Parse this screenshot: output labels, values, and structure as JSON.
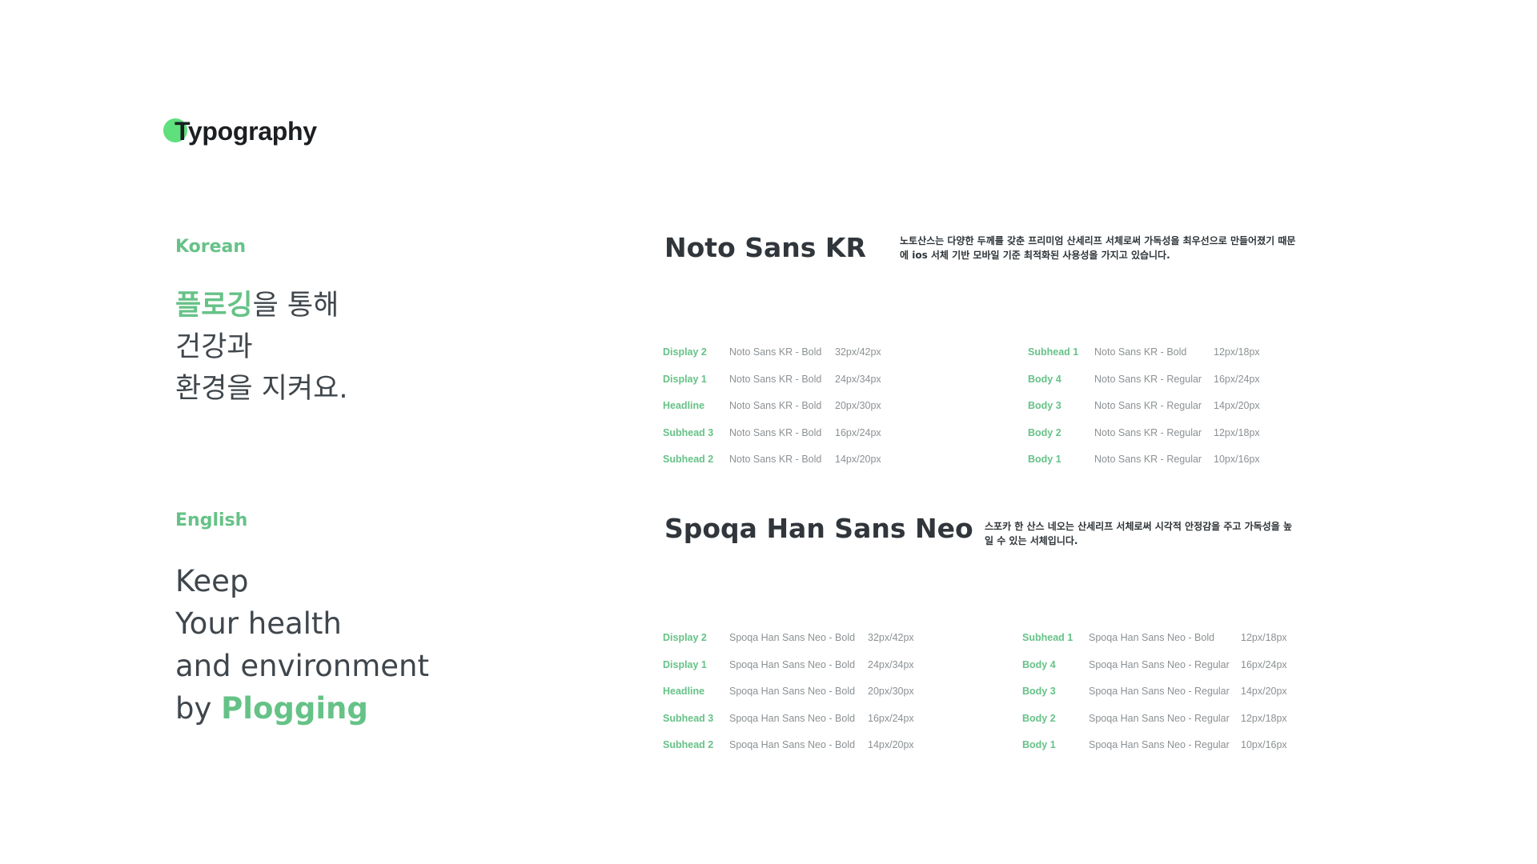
{
  "header": {
    "title": "Typography",
    "accent_color": "#5ee07c"
  },
  "korean": {
    "label": "Korean",
    "sample": {
      "line1_accent": "플로깅",
      "line1_rest": "을 통해",
      "line2": "건강과",
      "line3": "환경을 지켜요."
    }
  },
  "english": {
    "label": "English",
    "sample": {
      "line1": "Keep",
      "line2": "Your health",
      "line3": "and environment",
      "line4_prefix": "by ",
      "line4_accent": "Plogging"
    }
  },
  "noto": {
    "title": "Noto Sans KR",
    "description_line1": "노토산스는 다양한 두께를 갖춘 프리미엄 산세리프 서체로써 가독성을 최우선으로 만들어졌기 때문",
    "description_line2": "에 ios 서체 기반 모바일 기준 최적화된 사용성을 가지고 있습니다.",
    "left_specs": [
      {
        "name": "Display 2",
        "font": "Noto Sans KR - Bold",
        "size": "32px/42px"
      },
      {
        "name": "Display 1",
        "font": "Noto Sans KR - Bold",
        "size": "24px/34px"
      },
      {
        "name": "Headline",
        "font": "Noto Sans KR - Bold",
        "size": "20px/30px"
      },
      {
        "name": "Subhead 3",
        "font": "Noto Sans KR - Bold",
        "size": "16px/24px"
      },
      {
        "name": "Subhead 2",
        "font": "Noto Sans KR - Bold",
        "size": "14px/20px"
      }
    ],
    "right_specs": [
      {
        "name": "Subhead 1",
        "font": "Noto Sans KR - Bold",
        "size": "12px/18px"
      },
      {
        "name": "Body 4",
        "font": "Noto Sans KR - Regular",
        "size": "16px/24px"
      },
      {
        "name": "Body 3",
        "font": "Noto Sans KR - Regular",
        "size": "14px/20px"
      },
      {
        "name": "Body 2",
        "font": "Noto Sans KR - Regular",
        "size": "12px/18px"
      },
      {
        "name": "Body 1",
        "font": "Noto Sans KR - Regular",
        "size": "10px/16px"
      }
    ]
  },
  "spoqa": {
    "title": "Spoqa Han Sans Neo",
    "description_line1": "스포카 한 산스 네오는 산세리프 서체로써 시각적 안정감을 주고 가독성을 높",
    "description_line2": "일 수 있는 서체입니다.",
    "left_specs": [
      {
        "name": "Display 2",
        "font": "Spoqa Han Sans Neo - Bold",
        "size": "32px/42px"
      },
      {
        "name": "Display 1",
        "font": "Spoqa Han Sans Neo - Bold",
        "size": "24px/34px"
      },
      {
        "name": "Headline",
        "font": "Spoqa Han Sans Neo - Bold",
        "size": "20px/30px"
      },
      {
        "name": "Subhead 3",
        "font": "Spoqa Han Sans Neo - Bold",
        "size": "16px/24px"
      },
      {
        "name": "Subhead 2",
        "font": "Spoqa Han Sans Neo - Bold",
        "size": "14px/20px"
      }
    ],
    "right_specs": [
      {
        "name": "Subhead 1",
        "font": "Spoqa Han Sans Neo - Bold",
        "size": "12px/18px"
      },
      {
        "name": "Body 4",
        "font": "Spoqa Han Sans Neo - Regular",
        "size": "16px/24px"
      },
      {
        "name": "Body 3",
        "font": "Spoqa Han Sans Neo - Regular",
        "size": "14px/20px"
      },
      {
        "name": "Body 2",
        "font": "Spoqa Han Sans Neo - Regular",
        "size": "12px/18px"
      },
      {
        "name": "Body 1",
        "font": "Spoqa Han Sans Neo - Regular",
        "size": "10px/16px"
      }
    ]
  },
  "colors": {
    "green": "#66c287",
    "text_dark": "#30363b",
    "text_gray": "#8c9194"
  }
}
